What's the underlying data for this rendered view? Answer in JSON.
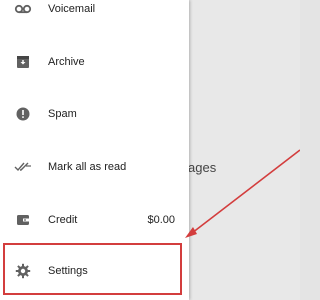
{
  "drawer": {
    "items": [
      {
        "label": "Voicemail",
        "icon": "voicemail-icon"
      },
      {
        "label": "Archive",
        "icon": "archive-icon"
      },
      {
        "label": "Spam",
        "icon": "spam-icon"
      },
      {
        "label": "Mark all as read",
        "icon": "mark-read-icon"
      },
      {
        "label": "Credit",
        "icon": "credit-icon",
        "value": "$0.00"
      },
      {
        "label": "Settings",
        "icon": "gear-icon"
      }
    ]
  },
  "background": {
    "partial_text": "ages"
  },
  "colors": {
    "highlight": "#d33d3d",
    "icon": "#616161",
    "drawer_bg": "#ffffff",
    "page_bg": "#e8e8e8"
  }
}
